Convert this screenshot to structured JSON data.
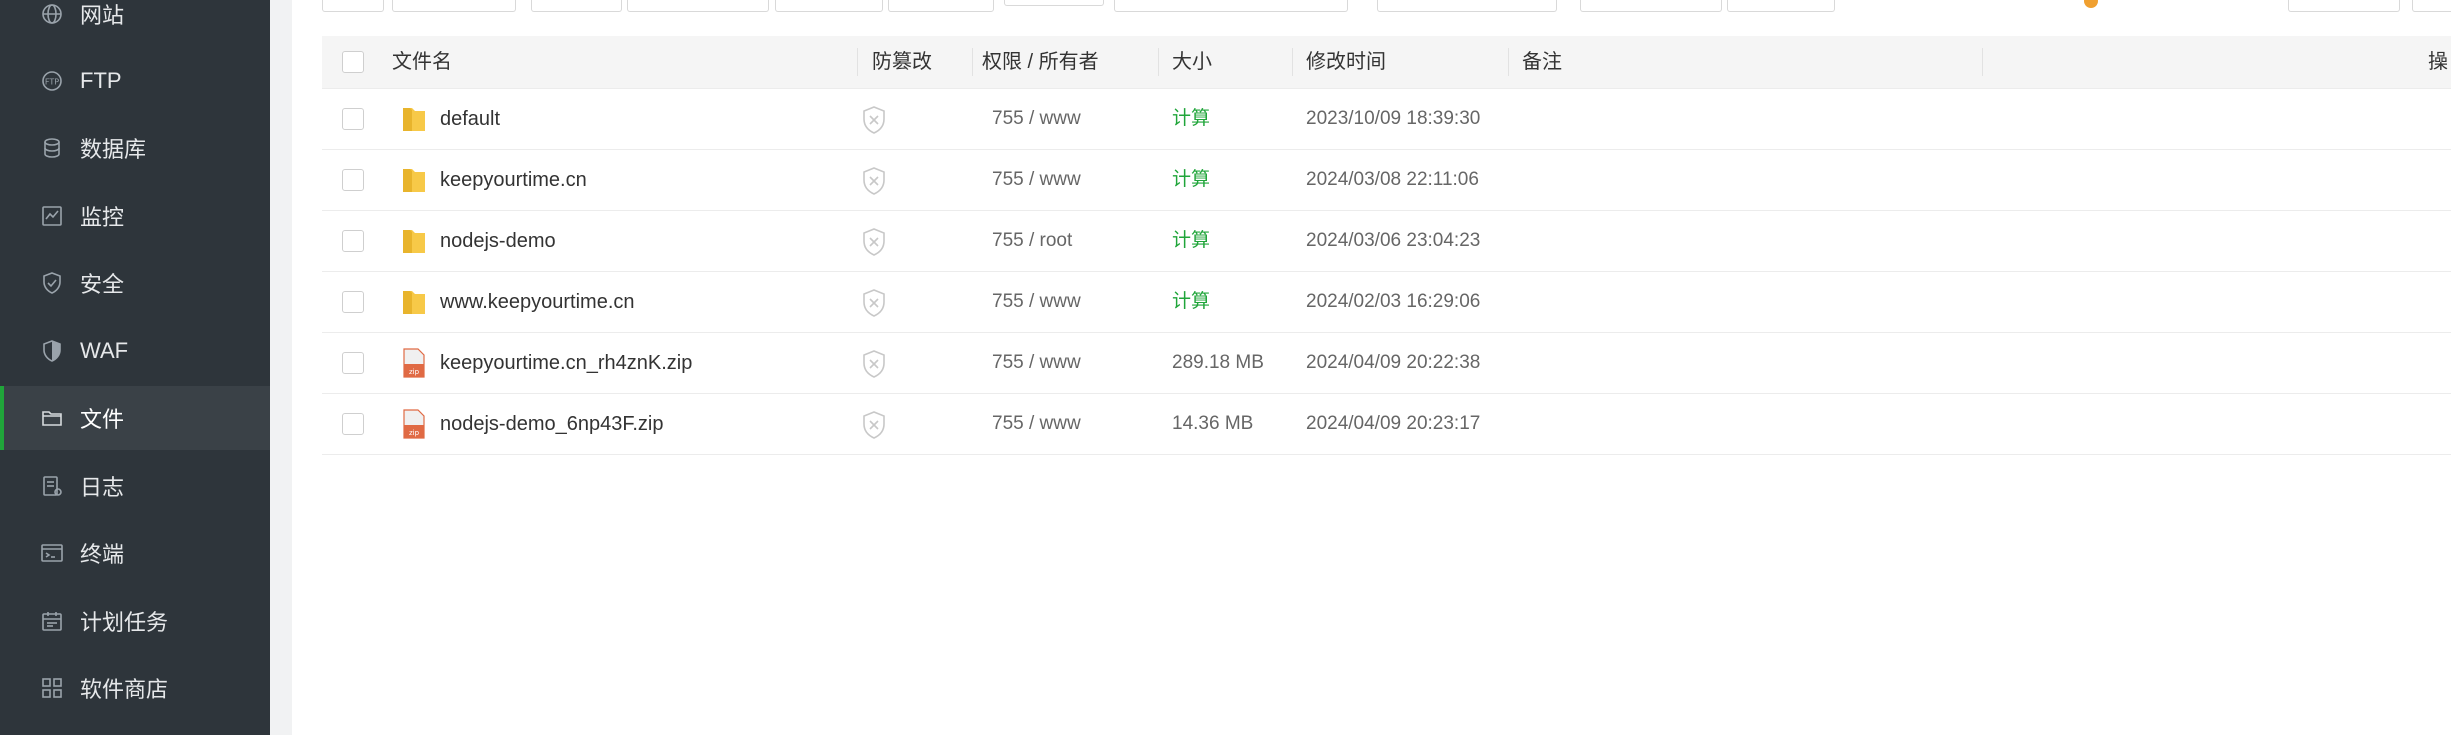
{
  "sidebar": {
    "items": [
      {
        "label": "网站",
        "icon": "globe-icon",
        "active": false
      },
      {
        "label": "FTP",
        "icon": "ftp-icon",
        "active": false
      },
      {
        "label": "数据库",
        "icon": "database-icon",
        "active": false
      },
      {
        "label": "监控",
        "icon": "monitor-icon",
        "active": false
      },
      {
        "label": "安全",
        "icon": "shield-check-icon",
        "active": false
      },
      {
        "label": "WAF",
        "icon": "waf-shield-icon",
        "active": false
      },
      {
        "label": "文件",
        "icon": "folder-icon",
        "active": true
      },
      {
        "label": "日志",
        "icon": "log-icon",
        "active": false
      },
      {
        "label": "终端",
        "icon": "terminal-icon",
        "active": false
      },
      {
        "label": "计划任务",
        "icon": "calendar-icon",
        "active": false
      },
      {
        "label": "软件商店",
        "icon": "apps-grid-icon",
        "active": false
      }
    ],
    "active_color": "#20a53a"
  },
  "table": {
    "headers": {
      "name": "文件名",
      "tamper": "防篡改",
      "permission": "权限 / 所有者",
      "size": "大小",
      "modified": "修改时间",
      "remark": "备注",
      "actions": "操"
    },
    "rows": [
      {
        "type": "folder",
        "name": "default",
        "permission": "755 / www",
        "size": "计算",
        "modified": "2023/10/09 18:39:30"
      },
      {
        "type": "folder",
        "name": "keepyourtime.cn",
        "permission": "755 / www",
        "size": "计算",
        "modified": "2024/03/08 22:11:06"
      },
      {
        "type": "folder",
        "name": "nodejs-demo",
        "permission": "755 / root",
        "size": "计算",
        "modified": "2024/03/06 23:04:23"
      },
      {
        "type": "folder",
        "name": "www.keepyourtime.cn",
        "permission": "755 / www",
        "size": "计算",
        "modified": "2024/02/03 16:29:06"
      },
      {
        "type": "zip",
        "name": "keepyourtime.cn_rh4znK.zip",
        "permission": "755 / www",
        "size": "289.18 MB",
        "modified": "2024/04/09 20:22:38"
      },
      {
        "type": "zip",
        "name": "nodejs-demo_6np43F.zip",
        "permission": "755 / www",
        "size": "14.36 MB",
        "modified": "2024/04/09 20:23:17"
      }
    ]
  }
}
